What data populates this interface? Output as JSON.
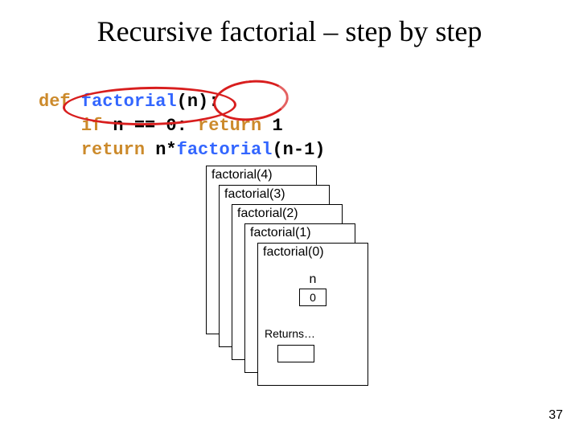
{
  "title": "Recursive factorial – step by step",
  "code": {
    "line1": {
      "kw": "def",
      "fn": " factorial",
      "params": "(n):"
    },
    "line2": {
      "indent": "    ",
      "kw1": "if",
      "expr": " n == 0: ",
      "kw2": "return",
      "val": " 1"
    },
    "line3": {
      "indent": "    ",
      "kw": "return",
      "expr": " n*",
      "fn": "factorial",
      "args": "(n-1)"
    }
  },
  "stack": {
    "frames": [
      {
        "label": "factorial(4)"
      },
      {
        "label": "factorial(3)"
      },
      {
        "label": "factorial(2)"
      },
      {
        "label": "factorial(1)"
      },
      {
        "label": "factorial(0)"
      }
    ],
    "var_name": "n",
    "var_value": "0",
    "returns_label": "Returns…",
    "returns_value": ""
  },
  "page_number": "37"
}
